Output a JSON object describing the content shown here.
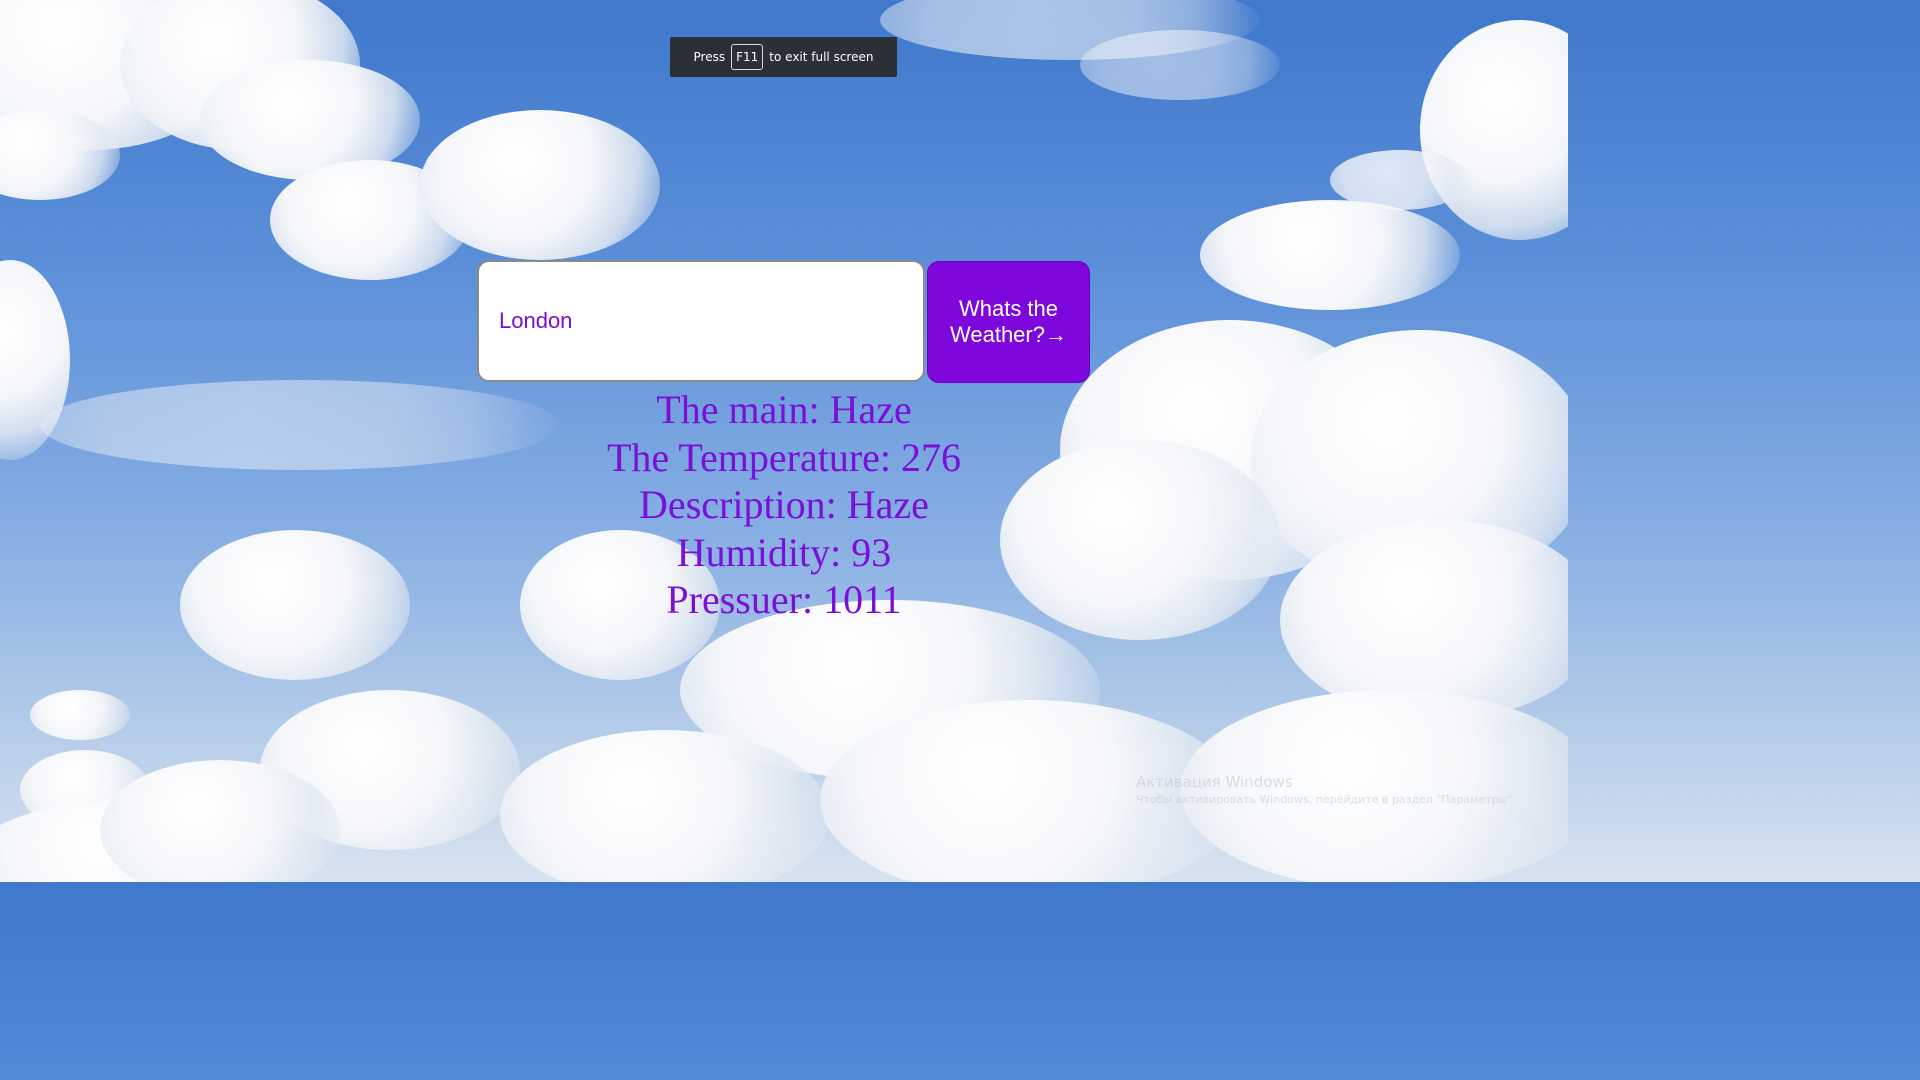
{
  "fullscreen_notice": {
    "prefix": "Press",
    "key": "F11",
    "suffix": "to exit full screen"
  },
  "search": {
    "value": "London"
  },
  "submit_button": {
    "label": "Whats the Weather?→"
  },
  "weather": {
    "main": "The main: Haze",
    "temperature": "The Temperature: 276",
    "description": "Description: Haze",
    "humidity": "Humidity: 93",
    "pressure": "Pressuer: 1011"
  },
  "windows_activation": {
    "title": "Активация Windows",
    "subtitle": "Чтобы активировать Windows, перейдите в раздел \"Параметры\"."
  },
  "colors": {
    "accent": "#7e07dc",
    "result_text": "#7a10d8",
    "sky": "#4a82d2"
  }
}
